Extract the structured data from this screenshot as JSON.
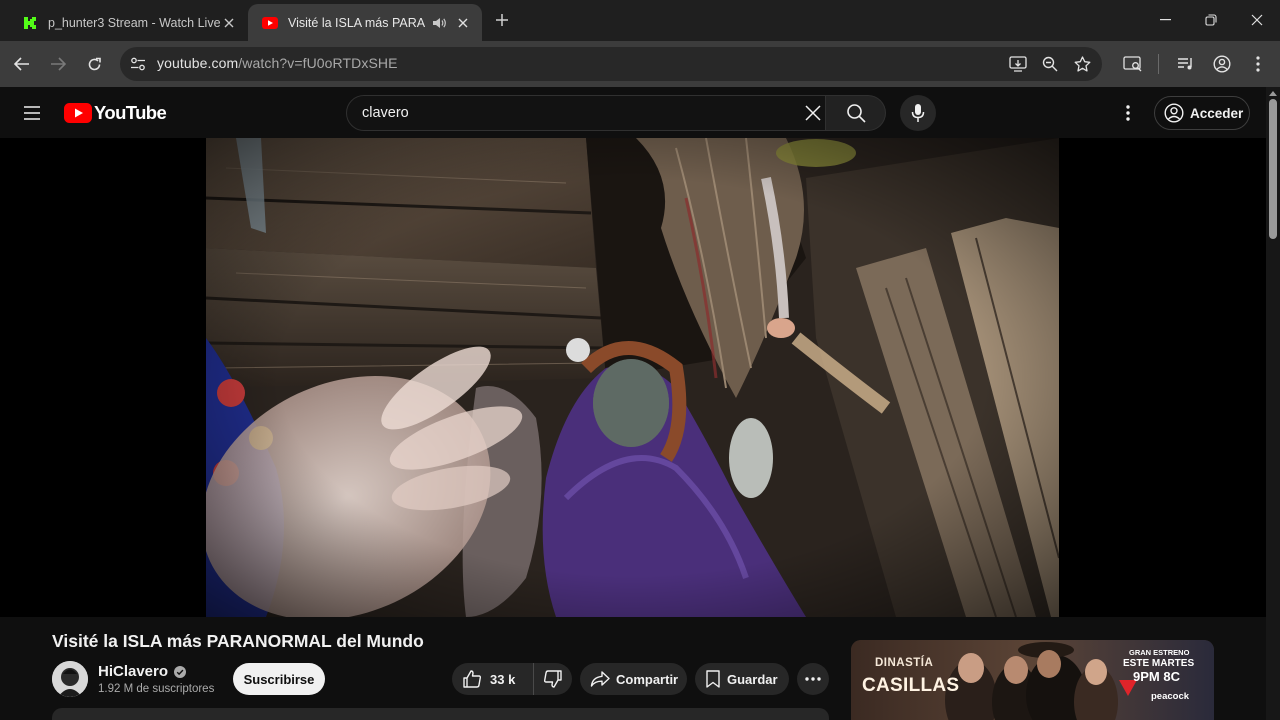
{
  "browser": {
    "tabs": [
      {
        "title": "p_hunter3 Stream - Watch Live",
        "active": false,
        "favicon": "kick-logo-icon"
      },
      {
        "title": "Visité la ISLA más PARANORMAL del Mundo",
        "active": true,
        "favicon": "youtube-logo-icon",
        "audio": true
      }
    ],
    "url_host": "youtube.com",
    "url_path": "/watch?v=fU0oRTDxSHE"
  },
  "youtube": {
    "logo_text": "YouTube",
    "search_value": "clavero",
    "signin_label": "Acceder"
  },
  "video": {
    "title": "Visité la ISLA más PARANORMAL del Mundo",
    "channel": "HiClavero",
    "subscribers": "1.92 M de suscriptores",
    "subscribe_label": "Suscribirse",
    "likes": "33 k",
    "share_label": "Compartir",
    "save_label": "Guardar"
  },
  "ad": {
    "brand_line1": "DINASTÍA",
    "brand_line2": "CASILLAS",
    "promo_line1": "GRAN ESTRENO",
    "promo_line2": "ESTE MARTES",
    "promo_line3": "9PM 8C",
    "promo_line4": "peacock"
  },
  "colors": {
    "youtube_red": "#ff0000",
    "kick_green": "#53fc18",
    "page_bg": "#0f0f0f"
  }
}
